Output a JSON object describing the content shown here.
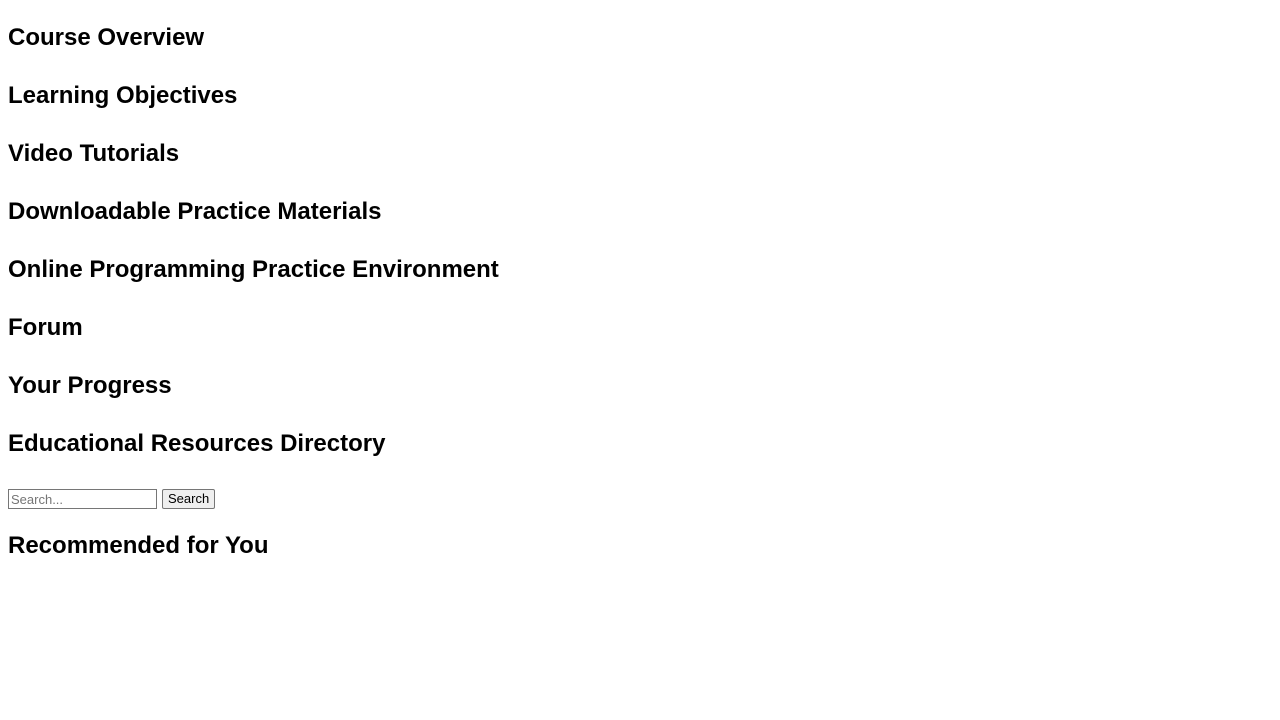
{
  "sections": {
    "course_overview": "Course Overview",
    "learning_objectives": "Learning Objectives",
    "video_tutorials": "Video Tutorials",
    "downloadable_materials": "Downloadable Practice Materials",
    "online_environment": "Online Programming Practice Environment",
    "forum": "Forum",
    "your_progress": "Your Progress",
    "resources_directory": "Educational Resources Directory",
    "recommended": "Recommended for You"
  },
  "search": {
    "placeholder": "Search...",
    "value": "",
    "button_label": "Search"
  }
}
